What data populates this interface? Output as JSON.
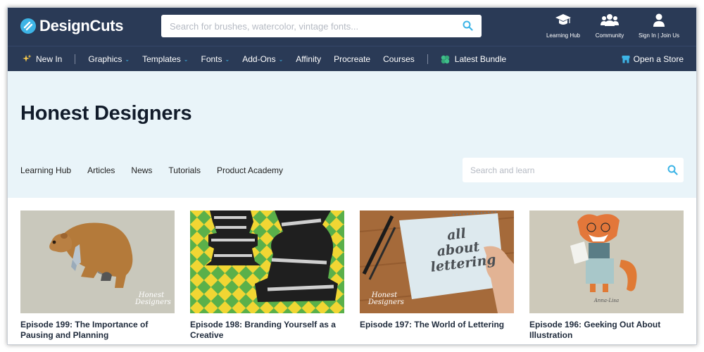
{
  "header": {
    "logo_text": "DesignCuts",
    "search_placeholder": "Search for brushes, watercolor, vintage fonts...",
    "icons": [
      {
        "name": "learning-hub",
        "label": "Learning Hub"
      },
      {
        "name": "community",
        "label": "Community"
      },
      {
        "name": "sign-in",
        "label": "Sign In | Join Us"
      }
    ]
  },
  "nav": {
    "new_in": "New In",
    "items": [
      {
        "label": "Graphics",
        "dropdown": true
      },
      {
        "label": "Templates",
        "dropdown": true
      },
      {
        "label": "Fonts",
        "dropdown": true
      },
      {
        "label": "Add-Ons",
        "dropdown": true
      },
      {
        "label": "Affinity",
        "dropdown": false
      },
      {
        "label": "Procreate",
        "dropdown": false
      },
      {
        "label": "Courses",
        "dropdown": false
      }
    ],
    "latest_bundle": "Latest Bundle",
    "open_store": "Open a Store",
    "chevron": "⌄"
  },
  "hero": {
    "title": "Honest Designers",
    "subnav": [
      "Learning Hub",
      "Articles",
      "News",
      "Tutorials",
      "Product Academy"
    ],
    "search_placeholder": "Search and learn"
  },
  "cards": [
    {
      "title": "Episode 199: The Importance of Pausing and Planning",
      "image": "bear-illustration",
      "watermark": "Honest Designers"
    },
    {
      "title": "Episode 198: Branding Yourself as a Creative",
      "image": "chess-pieces-illustration"
    },
    {
      "title": "Episode 197: The World of Lettering",
      "image": "lettering-sketch-photo",
      "watermark": "Honest Designers",
      "lettering": "all about lettering"
    },
    {
      "title": "Episode 196: Geeking Out About Illustration",
      "image": "fox-illustration",
      "caption": "Anna-Lisa"
    }
  ],
  "colors": {
    "header_bg": "#2a3a56",
    "accent": "#3db4e6",
    "hero_bg": "#e9f4f9",
    "title_text": "#121c2b"
  }
}
